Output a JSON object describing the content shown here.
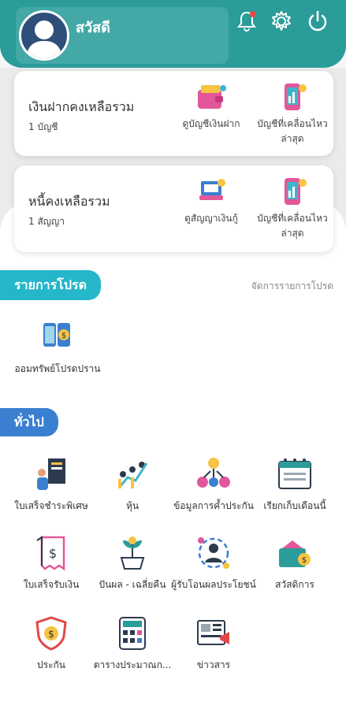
{
  "header": {
    "greeting": "สวัสดี"
  },
  "accounts_card": {
    "title": "เงินฝากคงเหลือรวม",
    "subtitle": "1 บัญชี",
    "actions": [
      {
        "label": "ดูบัญชีเงินฝาก"
      },
      {
        "label": "บัญชีที่เคลื่อนไหวล่าสุด"
      }
    ]
  },
  "loans_card": {
    "title": "หนี้คงเหลือรวม",
    "subtitle": "1 สัญญา",
    "actions": [
      {
        "label": "ดูสัญญาเงินกู้"
      },
      {
        "label": "บัญชีที่เคลื่อนไหวล่าสุด"
      }
    ]
  },
  "favorites": {
    "title": "รายการโปรด",
    "manage_label": "จัดการรายการโปรด",
    "items": [
      {
        "label": "ออมทรัพย์โปรดปราน"
      }
    ]
  },
  "general": {
    "title": "ทั่วไป",
    "items": [
      {
        "label": "ใบเสร็จชำระพิเศษ"
      },
      {
        "label": "หุ้น"
      },
      {
        "label": "ข้อมูลการค้ำประกัน"
      },
      {
        "label": "เรียกเก็บเดือนนี้"
      },
      {
        "label": "ใบเสร็จรับเงิน"
      },
      {
        "label": "ปันผล - เฉลี่ยคืน"
      },
      {
        "label": "ผู้รับโอนผลประโยชน์"
      },
      {
        "label": "สวัสดิการ"
      },
      {
        "label": "ประกัน"
      },
      {
        "label": "ตารางประมาณก..."
      },
      {
        "label": "ข่าวสาร"
      }
    ]
  },
  "colors": {
    "teal": "#2a9c9a",
    "pill_favorites": "#25b6c9",
    "pill_general": "#3b7fd1",
    "notif_dot": "#e84a4a"
  }
}
